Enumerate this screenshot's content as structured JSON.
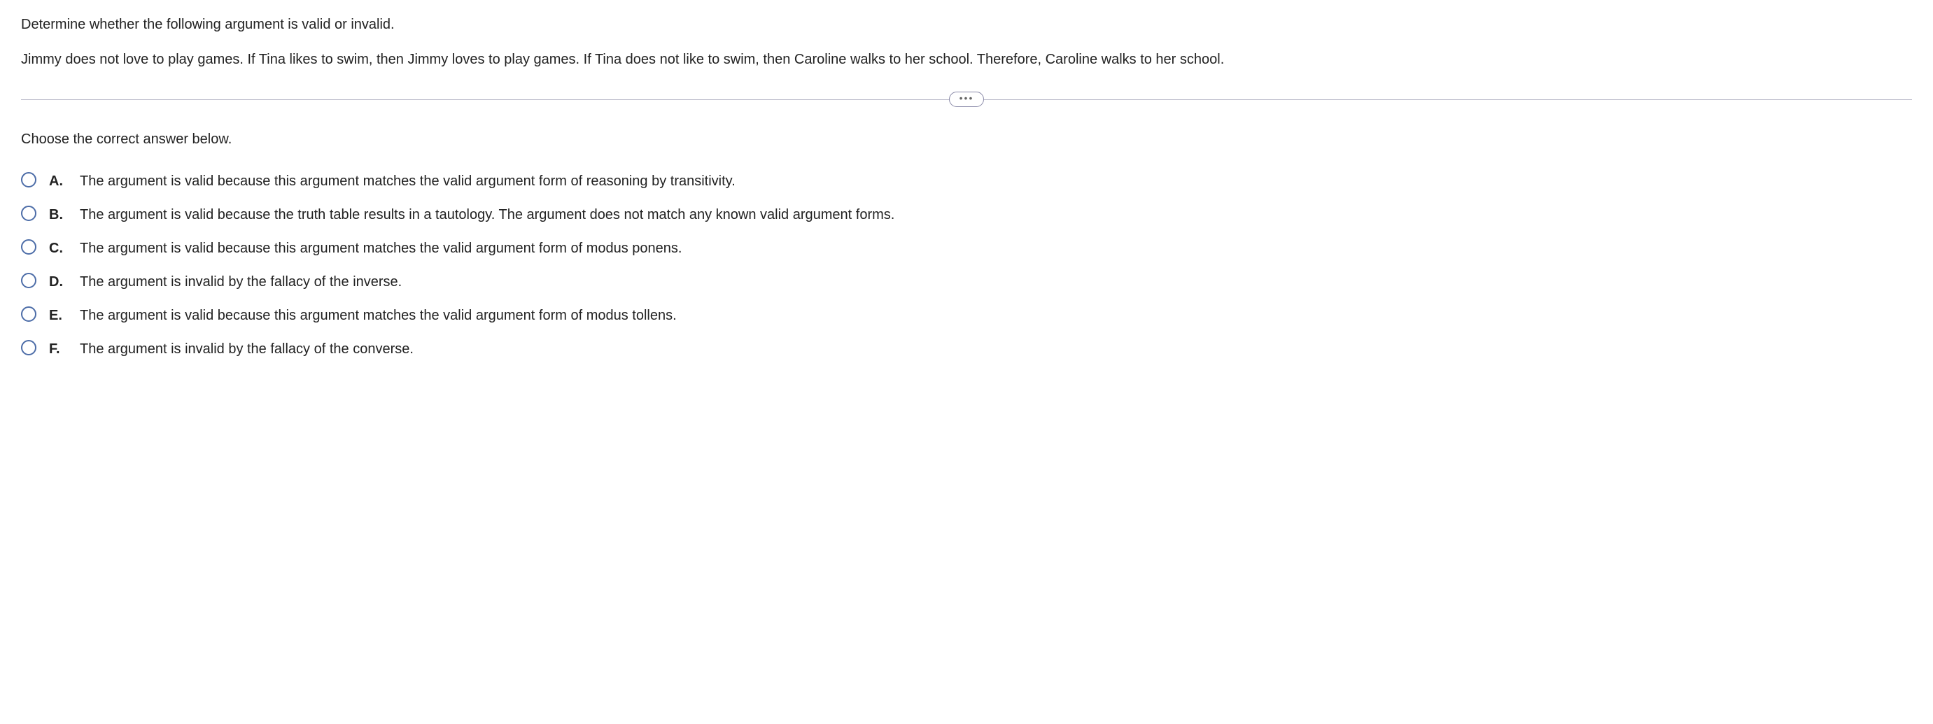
{
  "question": {
    "stem": "Determine whether the following argument is valid or invalid.",
    "body": "Jimmy does not love to play games. If Tina likes to swim, then Jimmy loves to play games. If Tina does not like to swim, then Caroline walks to her school. Therefore, Caroline walks to her school."
  },
  "prompt": "Choose the correct answer below.",
  "options": [
    {
      "letter": "A.",
      "text": "The argument is valid because this argument matches the valid argument form of reasoning by transitivity."
    },
    {
      "letter": "B.",
      "text": "The argument is valid because the truth table results in a tautology. The argument does not match any known valid argument forms."
    },
    {
      "letter": "C.",
      "text": "The argument is valid because this argument matches the valid argument form of modus ponens."
    },
    {
      "letter": "D.",
      "text": "The argument is invalid by the fallacy of the inverse."
    },
    {
      "letter": "E.",
      "text": "The argument is valid because this argument matches the valid argument form of modus tollens."
    },
    {
      "letter": "F.",
      "text": "The argument is invalid by the fallacy of the converse."
    }
  ]
}
